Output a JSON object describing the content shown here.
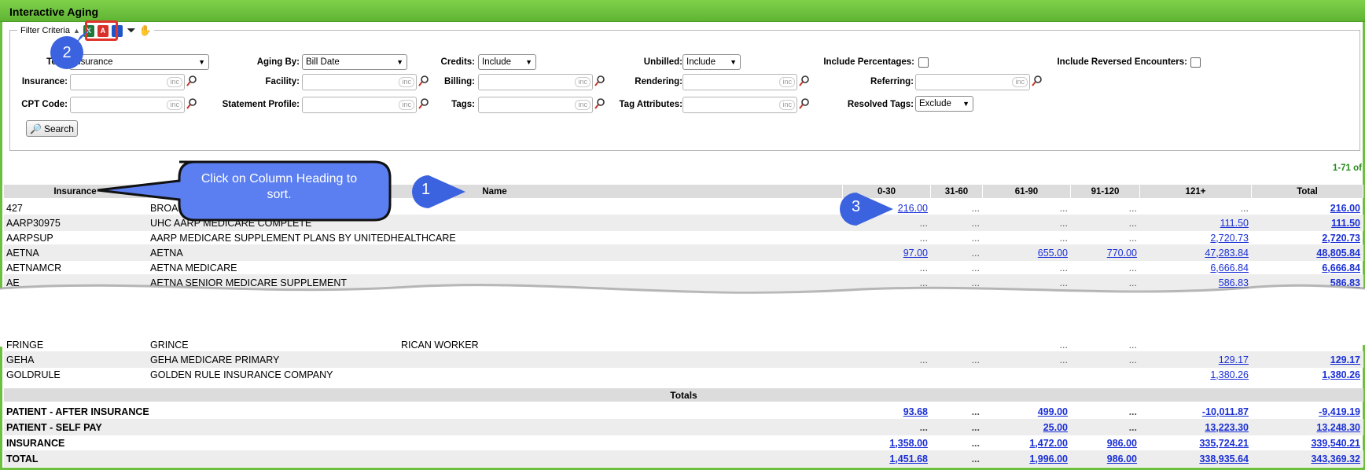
{
  "window": {
    "title": "Interactive Aging"
  },
  "filter": {
    "legend": "Filter Criteria",
    "totals_label": "Totals:",
    "totals_value": "Insurance",
    "aging_by_label": "Aging By:",
    "aging_by_value": "Bill Date",
    "credits_label": "Credits:",
    "credits_value": "Include",
    "unbilled_label": "Unbilled:",
    "unbilled_value": "Include",
    "include_pct_label": "Include Percentages:",
    "include_reversed_label": "Include Reversed Encounters:",
    "insurance_label": "Insurance:",
    "facility_label": "Facility:",
    "billing_label": "Billing:",
    "rendering_label": "Rendering:",
    "referring_label": "Referring:",
    "cpt_label": "CPT Code:",
    "statement_profile_label": "Statement Profile:",
    "tags_label": "Tags:",
    "tag_attributes_label": "Tag Attributes:",
    "resolved_tags_label": "Resolved Tags:",
    "resolved_tags_value": "Exclude",
    "inc": "inc",
    "search_label": "Search"
  },
  "range_text": "1-71 of",
  "columns": [
    "Insurance",
    "Name",
    "0-30",
    "31-60",
    "61-90",
    "91-120",
    "121+",
    "Total"
  ],
  "rows": [
    {
      "code": "427",
      "name": "BROAD",
      "c0": "216.00",
      "c1": "...",
      "c2": "...",
      "c3": "...",
      "c4": "...",
      "total": "216.00"
    },
    {
      "code": "AARP30975",
      "name": "UHC AARP MEDICARE COMPLETE",
      "c0": "...",
      "c1": "...",
      "c2": "...",
      "c3": "...",
      "c4": "111.50",
      "total": "111.50"
    },
    {
      "code": "AARPSUP",
      "name": "AARP MEDICARE SUPPLEMENT PLANS BY UNITEDHEALTHCARE",
      "c0": "...",
      "c1": "...",
      "c2": "...",
      "c3": "...",
      "c4": "2,720.73",
      "total": "2,720.73"
    },
    {
      "code": "AETNA",
      "name": "AETNA",
      "c0": "97.00",
      "c1": "...",
      "c2": "655.00",
      "c3": "770.00",
      "c4": "47,283.84",
      "total": "48,805.84"
    },
    {
      "code": "AETNAMCR",
      "name": "AETNA MEDICARE",
      "c0": "...",
      "c1": "...",
      "c2": "...",
      "c3": "...",
      "c4": "6,666.84",
      "total": "6,666.84"
    },
    {
      "code": "AE",
      "name": "AETNA SENIOR MEDICARE SUPPLEMENT",
      "c0": "...",
      "c1": "...",
      "c2": "...",
      "c3": "...",
      "c4": "586.83",
      "total": "586.83"
    }
  ],
  "rows_after": [
    {
      "code": "FRINGE",
      "name": "GRINCE",
      "name2": "RICAN WORKER",
      "c0": "",
      "c1": "",
      "c2": "...",
      "c3": "...",
      "c4": "",
      "total": ""
    },
    {
      "code": "GEHA",
      "name": "GEHA MEDICARE PRIMARY",
      "c0": "...",
      "c1": "...",
      "c2": "...",
      "c3": "...",
      "c4": "129.17",
      "total": "129.17"
    },
    {
      "code": "GOLDRULE",
      "name": "GOLDEN RULE INSURANCE COMPANY",
      "c0": "",
      "c1": "",
      "c2": "",
      "c3": "",
      "c4": "1,380.26",
      "total": "1,380.26"
    }
  ],
  "totals_header": "Totals",
  "totals": [
    {
      "label": "PATIENT - AFTER INSURANCE",
      "c0": "93.68",
      "c1": "...",
      "c2": "499.00",
      "c3": "...",
      "c4": "-10,011.87",
      "total": "-9,419.19"
    },
    {
      "label": "PATIENT - SELF PAY",
      "c0": "...",
      "c1": "...",
      "c2": "25.00",
      "c3": "...",
      "c4": "13,223.30",
      "total": "13,248.30"
    },
    {
      "label": "INSURANCE",
      "c0": "1,358.00",
      "c1": "...",
      "c2": "1,472.00",
      "c3": "986.00",
      "c4": "335,724.21",
      "total": "339,540.21"
    },
    {
      "label": "TOTAL",
      "c0": "1,451.68",
      "c1": "...",
      "c2": "1,996.00",
      "c3": "986.00",
      "c4": "338,935.64",
      "total": "343,369.32"
    }
  ],
  "annotations": {
    "callout_text": "Click on Column Heading to sort.",
    "badge1": "1",
    "badge2": "2",
    "badge3": "3"
  },
  "colors": {
    "title_green": "#6cbf3f",
    "link_blue": "#1a2fd6",
    "callout_blue": "#5b7ef0",
    "badge_blue": "#3b63e0",
    "highlight_red": "#e0342b"
  }
}
